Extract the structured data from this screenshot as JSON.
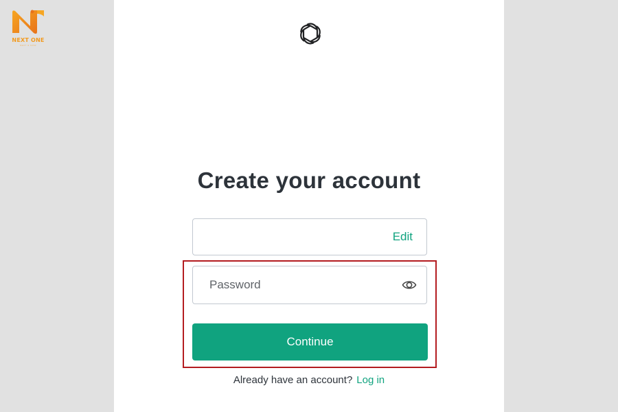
{
  "brand": {
    "name": "NEXT ONE",
    "tagline": "NEXT & NOW",
    "accent": "#f29a1f"
  },
  "header": {
    "logo_icon": "openai-logo-icon"
  },
  "main": {
    "title": "Create your account",
    "email_field": {
      "value": "",
      "edit_label": "Edit"
    },
    "password_field": {
      "placeholder": "Password",
      "value": "",
      "toggle_icon": "eye-icon"
    },
    "continue_button": {
      "label": "Continue"
    },
    "footer": {
      "prompt": "Already have an account?",
      "login_label": "Log in"
    }
  },
  "colors": {
    "accent": "#10a37f",
    "highlight": "#b31b1f",
    "background": "#e1e1e1",
    "text": "#2d333a"
  }
}
